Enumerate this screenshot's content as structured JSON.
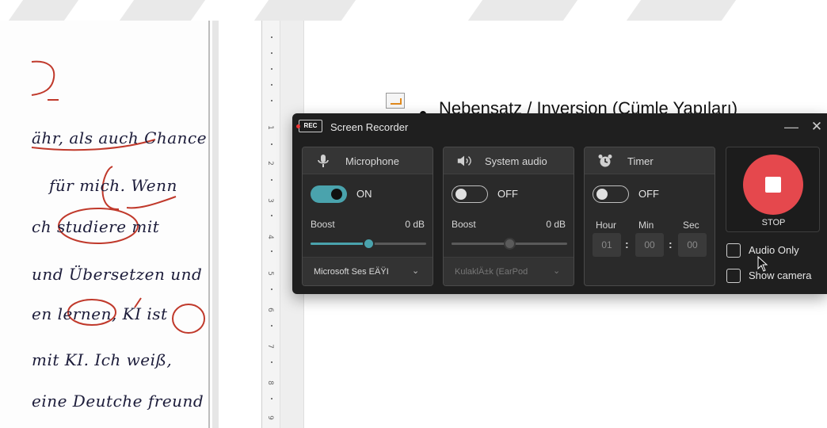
{
  "window": {
    "title": "Screen Recorder",
    "logo_text": "REC",
    "minimize_symbol": "—",
    "close_symbol": "✕"
  },
  "document": {
    "bullet_text": "Nebensatz / Inversion (Cümle Yapıları)",
    "ruler_numbers": [
      "1",
      "2",
      "3",
      "4",
      "5",
      "6",
      "7",
      "8",
      "9"
    ]
  },
  "handwriting": {
    "lines": [
      "ähr, als auch Chance",
      "für mich. Wenn",
      "ch studiere mit",
      "und Übersetzen und",
      "en lernen, KI ist",
      "mit KI. Ich weiß,",
      "eine Deutche freund"
    ]
  },
  "microphone": {
    "label": "Microphone",
    "icon": "microphone-icon",
    "toggle_state": "ON",
    "boost_label": "Boost",
    "boost_value": "0 dB",
    "slider_level": 0.5,
    "device": "Microsoft Ses EÄŸI",
    "chevron": "⌄"
  },
  "system_audio": {
    "label": "System audio",
    "icon": "speaker-icon",
    "toggle_state": "OFF",
    "boost_label": "Boost",
    "boost_value": "0 dB",
    "slider_level": 0.5,
    "device": "KulaklÄ±k (EarPod",
    "chevron": "⌄"
  },
  "timer": {
    "label": "Timer",
    "icon": "alarm-clock-icon",
    "toggle_state": "OFF",
    "columns": [
      "Hour",
      "Min",
      "Sec"
    ],
    "values": [
      "01",
      "00",
      "00"
    ],
    "separator": ":"
  },
  "controls": {
    "stop_label": "STOP",
    "audio_only_label": "Audio Only",
    "show_camera_label": "Show camera"
  },
  "colors": {
    "accent": "#4aa3ad",
    "stop_red": "#e5484d",
    "window_bg": "#1f1f1f"
  }
}
